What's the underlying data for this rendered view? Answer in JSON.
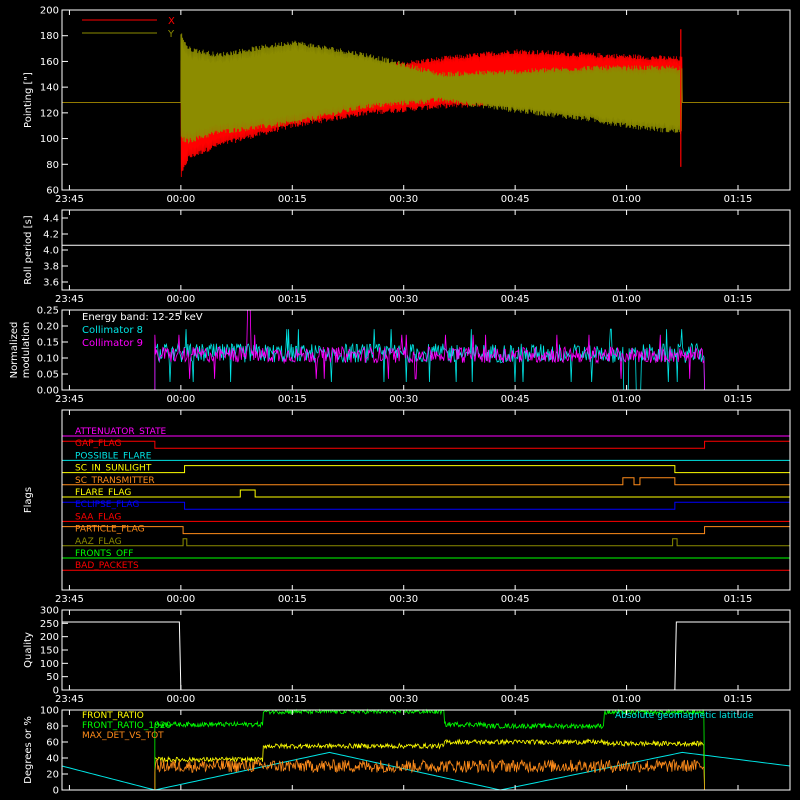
{
  "time_axis": {
    "ticks": [
      "23:45",
      "00:00",
      "00:15",
      "00:30",
      "00:45",
      "01:00",
      "01:15"
    ],
    "tick_minutes": [
      -15,
      0,
      15,
      30,
      45,
      60,
      75
    ],
    "range_minutes": [
      -16,
      82
    ]
  },
  "colors": {
    "background": "#000000",
    "axes": "#ffffff",
    "x_red": "#ff0000",
    "y_olive": "#8c8c00",
    "cyan": "#00e5e5",
    "magenta": "#ff00ff",
    "green": "#00ff00",
    "yellow": "#ffff00",
    "orange": "#ff8c1a",
    "blue": "#0000ff"
  },
  "chart_data": [
    {
      "type": "line",
      "panel": "pointing",
      "ylabel": "Pointing [\"]",
      "ylim": [
        60,
        200
      ],
      "yticks": [
        60,
        80,
        100,
        120,
        140,
        160,
        180,
        200
      ],
      "series": [
        {
          "name": "X",
          "color": "#ff0000",
          "x": [
            -16,
            0,
            1,
            5,
            15,
            25,
            35,
            45,
            55,
            60,
            67.5,
            82
          ],
          "upper": [
            128,
            160,
            155,
            150,
            160,
            155,
            162,
            168,
            165,
            164,
            162,
            128
          ],
          "lower": [
            128,
            70,
            85,
            95,
            110,
            120,
            125,
            128,
            126,
            125,
            124,
            128
          ]
        },
        {
          "name": "Y",
          "color": "#8c8c00",
          "x": [
            -16,
            0,
            1,
            5,
            15,
            25,
            35,
            45,
            55,
            60,
            67.5,
            82
          ],
          "upper": [
            128,
            182,
            170,
            165,
            175,
            165,
            150,
            152,
            155,
            155,
            155,
            128
          ],
          "lower": [
            128,
            100,
            98,
            105,
            112,
            125,
            130,
            122,
            115,
            110,
            105,
            128
          ]
        }
      ]
    },
    {
      "type": "line",
      "panel": "roll_period",
      "ylabel": "Roll period [s]",
      "ylim": [
        3.5,
        4.5
      ],
      "yticks": [
        3.6,
        3.8,
        4.0,
        4.2,
        4.4
      ],
      "series": [
        {
          "name": "",
          "x": [
            -16,
            82
          ],
          "values": [
            4.06,
            4.06
          ]
        }
      ]
    },
    {
      "type": "line",
      "panel": "modulation",
      "ylabel": "Normalized modulation",
      "ylim": [
        0,
        0.25
      ],
      "yticks": [
        0.0,
        0.05,
        0.1,
        0.15,
        0.2,
        0.25
      ],
      "annotation": "Energy band: 12-25 keV",
      "series": [
        {
          "name": "Collimator 8",
          "color": "#00e5e5",
          "active": [
            -3.5,
            70.5
          ],
          "mean": 0.115,
          "spread": 0.03,
          "dropouts": [
            [
              59.5,
              60.3
            ],
            [
              61.2,
              62.0
            ]
          ]
        },
        {
          "name": "Collimator 9",
          "color": "#ff00ff",
          "active": [
            -3.5,
            70.5
          ],
          "mean": 0.11,
          "spread": 0.025,
          "spike": [
            9.2,
            0.25
          ]
        }
      ]
    },
    {
      "type": "line",
      "panel": "flags",
      "ylabel": "Flags",
      "series": [
        {
          "name": "ATTENUATOR_STATE",
          "color": "#ff00ff",
          "high": []
        },
        {
          "name": "GAP_FLAG",
          "color": "#ff0000",
          "high": [
            [
              -16,
              -3.5
            ],
            [
              70.5,
              82
            ]
          ]
        },
        {
          "name": "POSSIBLE_FLARE",
          "color": "#00e5e5",
          "high": []
        },
        {
          "name": "SC_IN_SUNLIGHT",
          "color": "#ffff00",
          "high": [
            [
              0.5,
              66.5
            ]
          ]
        },
        {
          "name": "SC_TRANSMITTER",
          "color": "#ff8c1a",
          "high": [
            [
              59.5,
              61.0
            ],
            [
              61.8,
              66.5
            ]
          ]
        },
        {
          "name": "FLARE_FLAG",
          "color": "#ffff00",
          "high": [
            [
              8.0,
              10.0
            ]
          ]
        },
        {
          "name": "ECLIPSE_FLAG",
          "color": "#0000ff",
          "high": [
            [
              -16,
              0.5
            ],
            [
              66.5,
              82
            ]
          ]
        },
        {
          "name": "SAA_FLAG",
          "color": "#ff0000",
          "high": []
        },
        {
          "name": "PARTICLE_FLAG",
          "color": "#ff8c1a",
          "high": [
            [
              -16,
              0.3
            ],
            [
              70.5,
              82
            ]
          ]
        },
        {
          "name": "AAZ_FLAG",
          "color": "#8c8c00",
          "high": [
            [
              0.3,
              0.8
            ],
            [
              66.2,
              66.8
            ]
          ]
        },
        {
          "name": "FRONTS_OFF",
          "color": "#00ff00",
          "high": []
        },
        {
          "name": "BAD_PACKETS",
          "color": "#ff0000",
          "high": []
        }
      ]
    },
    {
      "type": "line",
      "panel": "quality",
      "ylabel": "Quality",
      "ylim": [
        0,
        300
      ],
      "yticks": [
        0,
        50,
        100,
        150,
        200,
        250,
        300
      ],
      "series": [
        {
          "name": "",
          "x": [
            -16,
            -0.2,
            0,
            66.5,
            66.7,
            82
          ],
          "values": [
            255,
            255,
            0,
            0,
            255,
            255
          ]
        }
      ]
    },
    {
      "type": "line",
      "panel": "ratios",
      "ylabel": "Degrees or %",
      "ylim": [
        0,
        100
      ],
      "yticks": [
        0,
        20,
        40,
        60,
        80,
        100
      ],
      "series": [
        {
          "name": "FRONT_RATIO",
          "color": "#ffff00",
          "active": [
            -3.5,
            70.5
          ],
          "segments": [
            [
              -3.5,
              11,
              38
            ],
            [
              11,
              35.5,
              55
            ],
            [
              35.5,
              57,
              60
            ],
            [
              57,
              70.5,
              58
            ]
          ],
          "noise": 3
        },
        {
          "name": "FRONT_RATIO_1020",
          "color": "#00ff00",
          "active": [
            -3.5,
            70.5
          ],
          "segments": [
            [
              -3.5,
              11,
              82
            ],
            [
              11,
              35.5,
              98
            ],
            [
              35.5,
              41,
              82
            ],
            [
              41,
              55,
              80
            ],
            [
              55,
              57,
              80
            ],
            [
              57,
              70.5,
              97
            ]
          ],
          "noise": 3
        },
        {
          "name": "MAX_DET_VS_TOT",
          "color": "#ff8c1a",
          "active": [
            -3.5,
            70.5
          ],
          "mean": 30,
          "noise": 8
        },
        {
          "name": "Absolute geomagnetic latitude",
          "color": "#00e5e5",
          "x": [
            -16,
            -3.5,
            20,
            43,
            67.5,
            82
          ],
          "values": [
            30,
            0,
            47,
            0,
            47,
            30
          ]
        }
      ]
    }
  ]
}
